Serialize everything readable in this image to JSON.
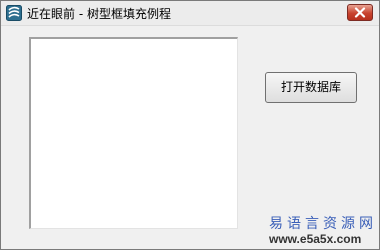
{
  "window": {
    "title": "近在眼前 - 树型框填充例程",
    "icon": "app-icon"
  },
  "titlebar": {
    "close_icon": "close-icon",
    "close_color": "#c8432e"
  },
  "main": {
    "open_db_label": "打开数据库"
  },
  "watermark": {
    "site_name": "易语言资源网",
    "url": "www.e5a5x.com"
  }
}
